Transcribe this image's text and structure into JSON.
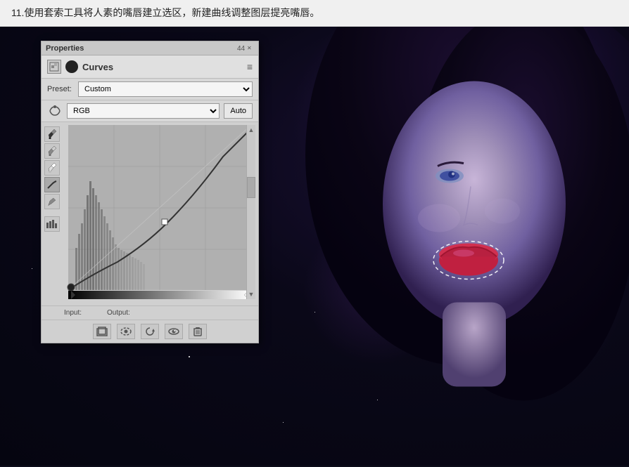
{
  "instruction": {
    "text": "11.使用套索工具将人素的嘴唇建立选区，新建曲线调整图层提亮嘴唇。"
  },
  "panel": {
    "title": "Properties",
    "curves_label": "Curves",
    "menu_icon": "≡",
    "titlebar_left": "44",
    "titlebar_close": "✕",
    "preset_label": "Preset:",
    "preset_value": "Custom",
    "rgb_label": "RGB",
    "auto_label": "Auto",
    "input_label": "Input:",
    "output_label": "Output:",
    "icons": {
      "pencil1": "╱",
      "pencil2": "╲",
      "pencil3": "✎",
      "curve": "∿",
      "corner": "⌐",
      "histogram": "▓"
    },
    "toolbar": {
      "crop": "⊡",
      "eye_dashed": "◎",
      "undo": "↺",
      "eye": "◉",
      "trash": "🗑"
    }
  },
  "colors": {
    "panel_bg": "#d4d4d4",
    "panel_header": "#e0e0e0",
    "graph_bg": "#b8b8b8",
    "dark_bg": "#0e0c1e",
    "instruction_bg": "#f0f0f0"
  }
}
